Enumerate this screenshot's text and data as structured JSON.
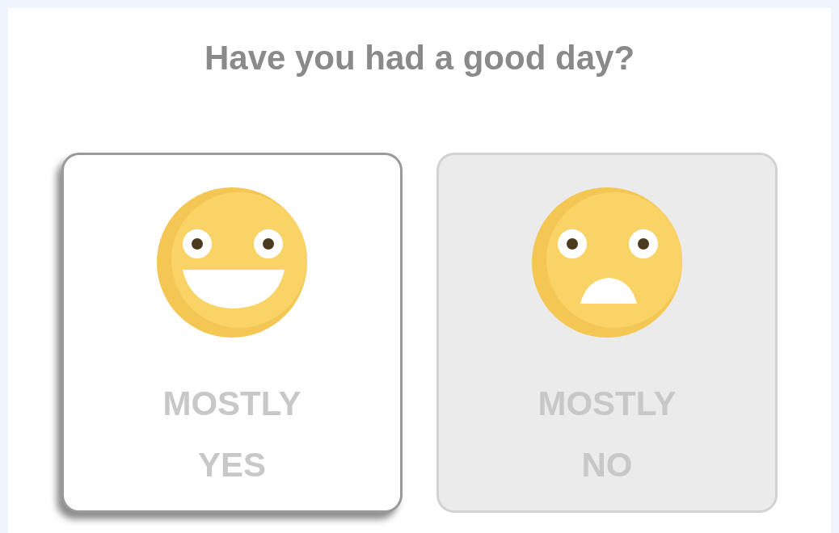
{
  "question": "Have you had a good day?",
  "options": [
    {
      "kind": "happy",
      "label": "MOSTLY YES",
      "selected": true
    },
    {
      "kind": "sad",
      "label": "MOSTLY NO",
      "selected": false
    }
  ]
}
